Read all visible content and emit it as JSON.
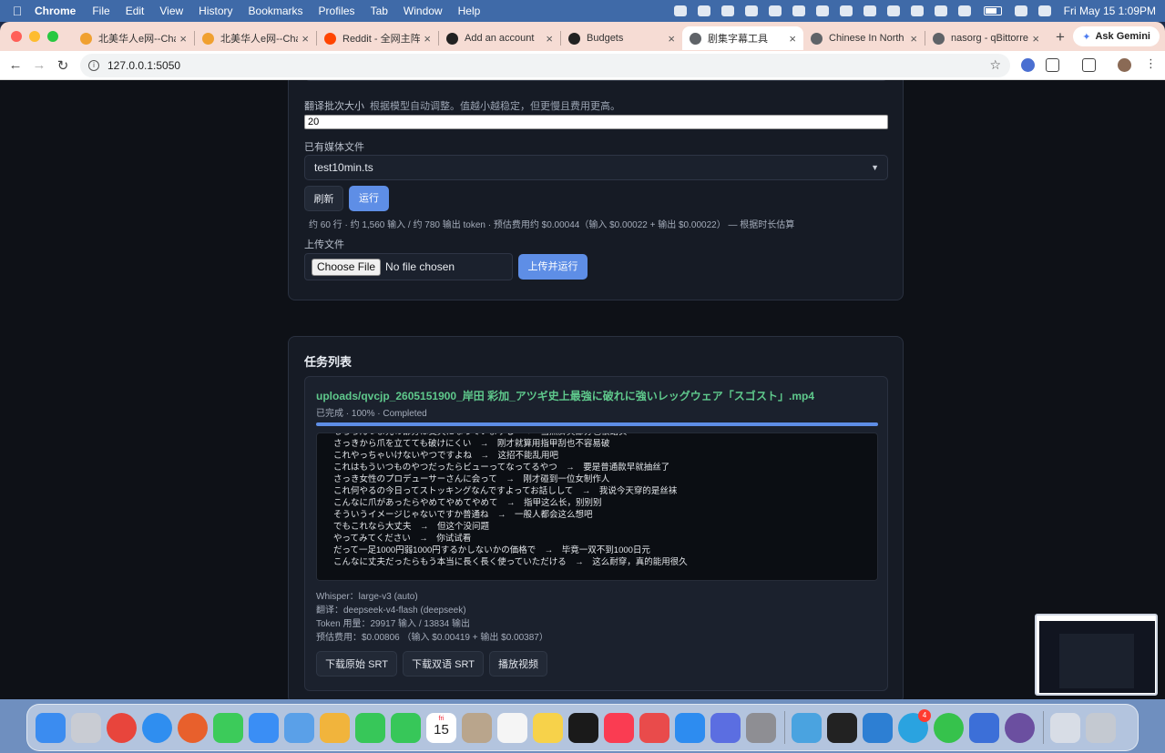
{
  "menubar": {
    "app_name": "Chrome",
    "menus": [
      "File",
      "Edit",
      "View",
      "History",
      "Bookmarks",
      "Profiles",
      "Tab",
      "Window",
      "Help"
    ],
    "clock": "Fri May 15  1:09PM"
  },
  "browser": {
    "tabs": [
      {
        "label": "北美华人e网--Chat",
        "favicon_color": "#f0a030"
      },
      {
        "label": "北美华人e网--Chat",
        "favicon_color": "#f0a030"
      },
      {
        "label": "Reddit - 全网主阵地",
        "favicon_color": "#ff4500"
      },
      {
        "label": "Add an account",
        "favicon_color": "#222222"
      },
      {
        "label": "Budgets",
        "favicon_color": "#222222"
      },
      {
        "label": "剧集字幕工具",
        "favicon_color": "#5f6368",
        "active": true
      },
      {
        "label": "Chinese In North A",
        "favicon_color": "#5f6368"
      },
      {
        "label": "nasorg - qBittorren",
        "favicon_color": "#5f6368"
      }
    ],
    "ask_gemini": "Ask Gemini",
    "url": "127.0.0.1:5050"
  },
  "form": {
    "batch_label": "翻译批次大小",
    "batch_hint": "根据模型自动调整。值越小越稳定，但更慢且费用更高。",
    "batch_value": "20",
    "media_label": "已有媒体文件",
    "media_selected": "test10min.ts",
    "refresh_label": "刷新",
    "run_label": "运行",
    "estimate_text": "约 60 行 · 约 1,560 输入 / 约 780 输出 token · 预估费用约 $0.00044（输入 $0.00022 + 输出 $0.00022） — 根据时长估算",
    "upload_label": "上传文件",
    "choose_file": "Choose File",
    "no_file": "No file chosen",
    "upload_run_label": "上传并运行"
  },
  "tasks": {
    "title": "任务列表",
    "items": [
      {
        "name": "uploads/qvcjp_2605151900_岸田 彩加_アツギ史上最強に破れに強いレッグウェア「スゴスト」.mp4",
        "status": "已完成 · 100% · Completed",
        "progress": 100,
        "log": [
          "もちろんつま先の部分は丈夫になっていますし　→　当然脚尖部分也很结实",
          "さっきから爪を立てても破けにくい　→　刚才就算用指甲刮也不容易破",
          "これやっちゃいけないやつですよね　→　这招不能乱用吧",
          "これはもういつものやつだったらビューってなってるやつ　→　要是普通款早就抽丝了",
          "さっき女性のプロデューサーさんに会って　→　刚才碰到一位女制作人",
          "これ何やるの今日ってストッキングなんですよってお話しして　→　我说今天穿的是丝袜",
          "こんなに爪があったらやめてやめてやめて　→　指甲这么长，别别别",
          "そういうイメージじゃないですか普通ね　→　一般人都会这么想吧",
          "でもこれなら大丈夫　→　但这个没问题",
          "やってみてください　→　你试试看",
          "だって一足1000円弱1000円するかしないかの価格で　→　毕竟一双不到1000日元",
          "こんなに丈夫だったらもう本当に長く長く使っていただける　→　这么耐穿，真的能用很久"
        ],
        "whisper": "Whisper：large-v3 (auto)",
        "translation": "翻译：deepseek-v4-flash (deepseek)",
        "tokens": "Token 用量：29917 输入 / 13834 输出",
        "cost": "预估费用：$0.00806 （输入 $0.00419 + 输出 $0.00387）",
        "download_original": "下载原始 SRT",
        "download_bilingual": "下载双语 SRT",
        "play_video": "播放视频"
      }
    ]
  },
  "dock": {
    "apps": [
      {
        "name": "finder",
        "color": "#3b8cf0"
      },
      {
        "name": "launchpad",
        "color": "#c9ccd3"
      },
      {
        "name": "chrome",
        "color": "#e8453c"
      },
      {
        "name": "safari",
        "color": "#2f8ef0"
      },
      {
        "name": "firefox",
        "color": "#e8602c"
      },
      {
        "name": "messages",
        "color": "#3ccb5a"
      },
      {
        "name": "mail",
        "color": "#3a8ef5"
      },
      {
        "name": "maps",
        "color": "#5aa0e8"
      },
      {
        "name": "photos",
        "color": "#f1b43c"
      },
      {
        "name": "facetime",
        "color": "#37c759"
      },
      {
        "name": "phone",
        "color": "#37c759"
      },
      {
        "name": "calendar",
        "color": "#ffffff"
      },
      {
        "name": "contacts",
        "color": "#b9a58c"
      },
      {
        "name": "reminders",
        "color": "#f5f5f5"
      },
      {
        "name": "notes",
        "color": "#f7d24a"
      },
      {
        "name": "tv",
        "color": "#1a1a1a"
      },
      {
        "name": "music",
        "color": "#fa3c52"
      },
      {
        "name": "rocket",
        "color": "#e94b4b"
      },
      {
        "name": "app-store",
        "color": "#2d8cf0"
      },
      {
        "name": "simulator",
        "color": "#5b6ee1"
      },
      {
        "name": "system-settings",
        "color": "#8e8e93"
      },
      {
        "name": "preview",
        "color": "#4aa3e0"
      },
      {
        "name": "terminal",
        "color": "#222222"
      },
      {
        "name": "vscode",
        "color": "#2d7fd3"
      },
      {
        "name": "telegram",
        "color": "#2aa3e0"
      },
      {
        "name": "wechat",
        "color": "#36c24c"
      },
      {
        "name": "db-client",
        "color": "#3c6fd8"
      },
      {
        "name": "media-player",
        "color": "#6b4fa0"
      },
      {
        "name": "downloads",
        "color": "#d8dde6"
      },
      {
        "name": "trash",
        "color": "#c4c9d1"
      }
    ],
    "calendar_day": "fri",
    "calendar_date": "15",
    "telegram_badge": "4"
  }
}
